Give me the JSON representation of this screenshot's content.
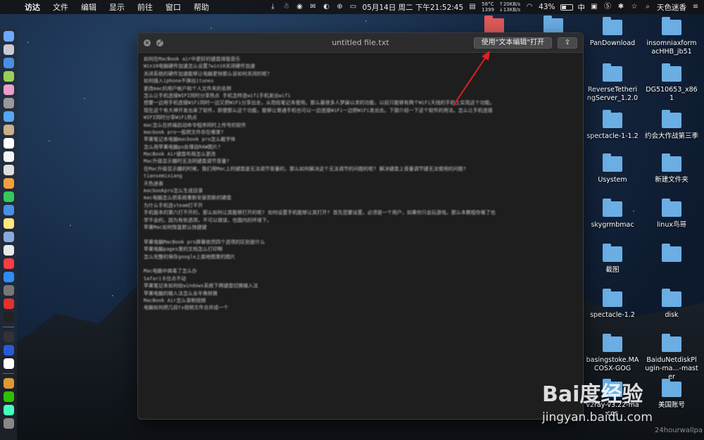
{
  "menubar": {
    "app_name": "访达",
    "menus": [
      "文件",
      "编辑",
      "显示",
      "前往",
      "窗口",
      "帮助"
    ],
    "status": {
      "temp": "58°C",
      "fan": "1399",
      "net_up": "↑20KB/s",
      "net_down": "↓13KB/s",
      "datetime": "05月14日 周二 下午21:52:45",
      "battery": "43%",
      "input_method": "中",
      "user": "天色迷香"
    }
  },
  "window": {
    "title": "untitled file.txt",
    "open_with_label": "使用\"文本编辑\"打开",
    "share_label": "⇪",
    "lines": [
      "如何在MacBook air中更好的键盘排版音乐",
      "Win10电脑硬件加速怎么设置?win10关闭硬件加速",
      "关闭系统的硬件加速能够让电脑更快那么该如何关闭的呢?",
      "如何插入iphone不弹出itunes",
      "更改mac的用户帐户和个人文件夹的名称",
      "怎么让手机连接WIFI同时分享热点 手机怎样连wifi手机发出wifi",
      "想要一边用手机连接WiFi同时一边又把WiFi分享出去，从而给笔记本使用。那么最很多人梦寐以求的功能，以前只能够有两个WiFi天线的手机上实现这个功能。",
      "现在这个有大神开发出来了软件，即便那么这个功能，能够让普通手机也可以一边连接WiFi一边把WiFi发出去。下面介绍一下这个软件的用法。怎么让手机连接",
      "WIFI同时分享WiFi热点",
      "mac怎么在终端启动命令程序同时上传号的软件",
      "macbook pro一般把文件存在哪里?",
      "苹果笔记本电脑macbook pro怎么截字体",
      "怎么用苹果电脑ps处理自RAW图片?",
      "MacBook Air键盘布局怎么更改",
      "Mac升级显示器时无法同键盘调节音量?",
      "在Mac升级显示器的时候，我们用Mac上的键盘是无法调节音量的，那么如何解决这个无法调节的问题的呢? 解决键盘上音量调节键无法使用的问题?",
      "tiansemixiang",
      "天色迷香",
      "macbookpro怎么生成目录",
      "mac电脑怎么把系统重新安装到新的硬盘",
      "为什么手机连steam打不开",
      "手机版本的第六打不开的，那么如何让其能够打开的呢? 如何设置手机能够让其打开? 首先您要设置，必须是一个用户，如果你只会玩游戏，那么本教程你看了也",
      "学不会的，因为有些选项，不可以错误，也国内的环境下。",
      "苹果Mac如何恢复默认快捷键",
      "",
      "苹果电脑MacBook pro屏幕依然四个选项的区别是什么",
      "苹果电脑pages里的文档怎么打印啊",
      "怎么完整的保存google上面地图里的图片",
      "",
      "Mac电脑中病毒了怎么办",
      "Safari卡住点不动",
      "苹果笔记本如何给windows系统下两键盘切换输入法",
      "苹果电脑的输入法怎么全半角转换",
      "MacBook Air怎么录制视频",
      "电脑如何把几段ts视频文件合并成一个"
    ]
  },
  "desktop_icons": [
    {
      "label": "PanDownload"
    },
    {
      "label": "insomniaxformacHHB_jb51"
    },
    {
      "label": "ReverseTetheringServer_1.2.0"
    },
    {
      "label": "DG510653_x861"
    },
    {
      "label": "spectacle-1-1.2"
    },
    {
      "label": "约会大作战第三季"
    },
    {
      "label": "Usystem"
    },
    {
      "label": "新建文件夹"
    },
    {
      "label": "skygrmbmac"
    },
    {
      "label": "linux鸟哥"
    },
    {
      "label": "截图"
    },
    {
      "label": ""
    },
    {
      "label": "spectacle-1.2"
    },
    {
      "label": "disk"
    },
    {
      "label": "basingstoke.MACOSX-GOG"
    },
    {
      "label": "BaiduNetdiskPlugin-ma...-master"
    },
    {
      "label": "v2ray-v3.22-macos"
    },
    {
      "label": "美国账号"
    }
  ],
  "watermark": {
    "logo": "Bai度经验",
    "url": "jingyan.baidu.com",
    "wallpaper": "24hourwallpa"
  },
  "colors": {
    "folder": "#6aaee4",
    "arrow": "#e02020"
  }
}
